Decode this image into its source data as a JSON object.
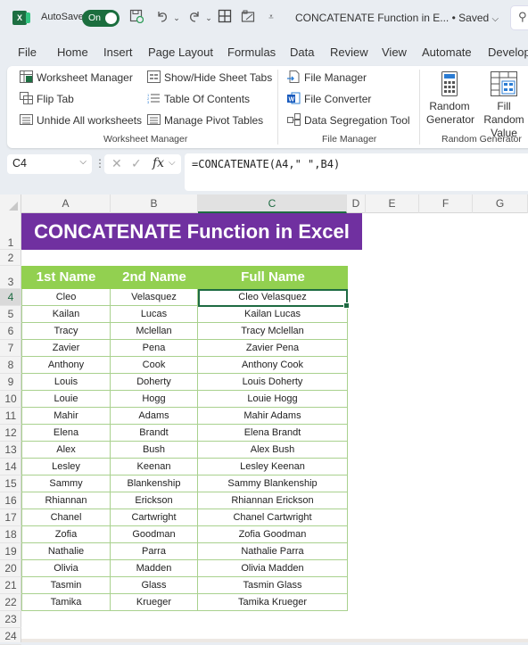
{
  "titlebar": {
    "autosave_label": "AutoSave",
    "autosave_state": "On",
    "document_title": "CONCATENATE Function in E...  • Saved",
    "icons": [
      "excel-logo-icon",
      "save-icon",
      "undo-icon",
      "redo-icon",
      "borders-icon",
      "camera-icon",
      "customize-qat-icon",
      "search-icon"
    ]
  },
  "tabs": [
    "File",
    "Home",
    "Insert",
    "Page Layout",
    "Formulas",
    "Data",
    "Review",
    "View",
    "Automate",
    "Develop"
  ],
  "ribbon": {
    "groups": [
      {
        "label": "Worksheet Manager",
        "items": [
          "Worksheet Manager",
          "Flip Tab",
          "Unhide All worksheets",
          "Show/Hide Sheet Tabs",
          "Table Of Contents",
          "Manage Pivot Tables"
        ]
      },
      {
        "label": "File Manager",
        "items": [
          "File Manager",
          "File Converter",
          "Data Segregation Tool"
        ]
      },
      {
        "label": "Random Generator",
        "items": [
          "Random Generator",
          "Fill Random Value"
        ]
      }
    ],
    "random_generator_line1": "Random",
    "random_generator_line2": "Generator",
    "fill_random_line1": "Fill Random",
    "fill_random_line2": "Value"
  },
  "formula_bar": {
    "name_box": "C4",
    "fx_label": "fx",
    "formula": "=CONCATENATE(A4,\" \",B4)"
  },
  "sheet": {
    "columns": [
      "A",
      "B",
      "C",
      "D",
      "E",
      "F",
      "G"
    ],
    "selected_column": "C",
    "selected_row": "4",
    "row_numbers": [
      "1",
      "2",
      "3",
      "4",
      "5",
      "6",
      "7",
      "8",
      "9",
      "10",
      "11",
      "12",
      "13",
      "14",
      "15",
      "16",
      "17",
      "18",
      "19",
      "20",
      "21",
      "22",
      "23",
      "24"
    ],
    "title": "CONCATENATE Function in Excel",
    "headers": [
      "1st Name",
      "2nd Name",
      "Full Name"
    ],
    "rows": [
      [
        "Cleo",
        "Velasquez",
        "Cleo Velasquez"
      ],
      [
        "Kailan",
        "Lucas",
        "Kailan Lucas"
      ],
      [
        "Tracy",
        "Mclellan",
        "Tracy Mclellan"
      ],
      [
        "Zavier",
        "Pena",
        "Zavier Pena"
      ],
      [
        "Anthony",
        "Cook",
        "Anthony Cook"
      ],
      [
        "Louis",
        "Doherty",
        "Louis Doherty"
      ],
      [
        "Louie",
        "Hogg",
        "Louie Hogg"
      ],
      [
        "Mahir",
        "Adams",
        "Mahir Adams"
      ],
      [
        "Elena",
        "Brandt",
        "Elena Brandt"
      ],
      [
        "Alex",
        "Bush",
        "Alex Bush"
      ],
      [
        "Lesley",
        "Keenan",
        "Lesley Keenan"
      ],
      [
        "Sammy",
        "Blankenship",
        "Sammy Blankenship"
      ],
      [
        "Rhiannan",
        "Erickson",
        "Rhiannan Erickson"
      ],
      [
        "Chanel",
        "Cartwright",
        "Chanel Cartwright"
      ],
      [
        "Zofia",
        "Goodman",
        "Zofia Goodman"
      ],
      [
        "Nathalie",
        "Parra",
        "Nathalie Parra"
      ],
      [
        "Olivia",
        "Madden",
        "Olivia Madden"
      ],
      [
        "Tasmin",
        "Glass",
        "Tasmin Glass"
      ],
      [
        "Tamika",
        "Krueger",
        "Tamika Krueger"
      ]
    ],
    "colors": {
      "title_bg": "#7030a0",
      "header_bg": "#92d050",
      "border": "#a9d18e",
      "selection": "#1e6b42"
    }
  }
}
